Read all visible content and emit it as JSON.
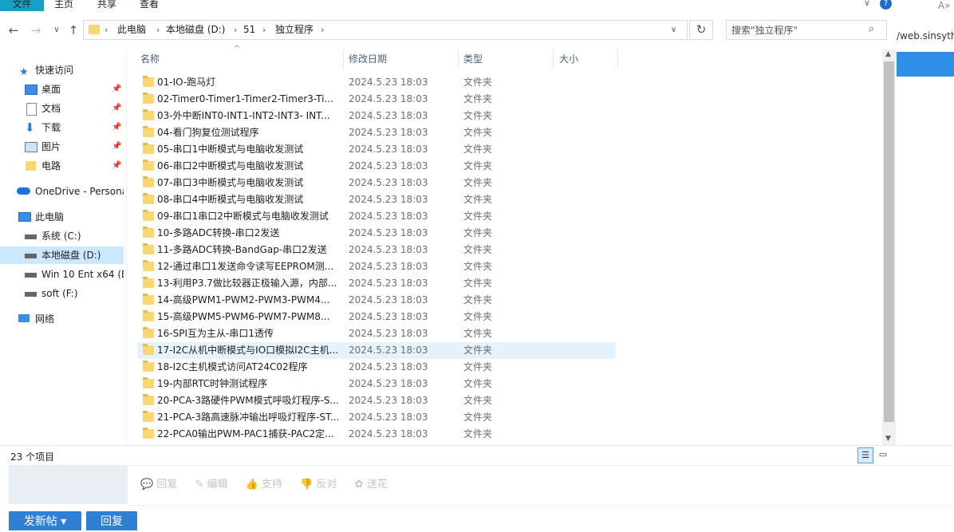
{
  "ribbon": {
    "tabs": [
      "文件",
      "主页",
      "共享",
      "查看"
    ]
  },
  "address": {
    "crumbs": [
      "此电脑",
      "本地磁盘 (D:)",
      "51",
      "独立程序"
    ]
  },
  "search": {
    "placeholder": "搜索\"独立程序\""
  },
  "sidebar": {
    "quick_access": "快速访问",
    "items": [
      "桌面",
      "文档",
      "下载",
      "图片",
      "电路"
    ],
    "onedrive": "OneDrive - Persona",
    "this_pc": "此电脑",
    "drives": [
      "系统 (C:)",
      "本地磁盘 (D:)",
      "Win 10 Ent x64 (E:",
      "soft (F:)"
    ],
    "network": "网络"
  },
  "columns": {
    "name": "名称",
    "date": "修改日期",
    "type": "类型",
    "size": "大小"
  },
  "files": [
    {
      "name": "01-IO-跑马灯",
      "date": "2024.5.23 18:03",
      "type": "文件夹"
    },
    {
      "name": "02-Timer0-Timer1-Timer2-Timer3-Ti...",
      "date": "2024.5.23 18:03",
      "type": "文件夹"
    },
    {
      "name": "03-外中断INT0-INT1-INT2-INT3- INT...",
      "date": "2024.5.23 18:03",
      "type": "文件夹"
    },
    {
      "name": "04-看门狗复位测试程序",
      "date": "2024.5.23 18:03",
      "type": "文件夹"
    },
    {
      "name": "05-串口1中断模式与电脑收发测试",
      "date": "2024.5.23 18:03",
      "type": "文件夹"
    },
    {
      "name": "06-串口2中断模式与电脑收发测试",
      "date": "2024.5.23 18:03",
      "type": "文件夹"
    },
    {
      "name": "07-串口3中断模式与电脑收发测试",
      "date": "2024.5.23 18:03",
      "type": "文件夹"
    },
    {
      "name": "08-串口4中断模式与电脑收发测试",
      "date": "2024.5.23 18:03",
      "type": "文件夹"
    },
    {
      "name": "09-串口1串口2中断模式与电脑收发测试",
      "date": "2024.5.23 18:03",
      "type": "文件夹"
    },
    {
      "name": "10-多路ADC转换-串口2发送",
      "date": "2024.5.23 18:03",
      "type": "文件夹"
    },
    {
      "name": "11-多路ADC转换-BandGap-串口2发送",
      "date": "2024.5.23 18:03",
      "type": "文件夹"
    },
    {
      "name": "12-通过串口1发送命令读写EEPROM测...",
      "date": "2024.5.23 18:03",
      "type": "文件夹"
    },
    {
      "name": "13-利用P3.7做比较器正极输入源，内部...",
      "date": "2024.5.23 18:03",
      "type": "文件夹"
    },
    {
      "name": "14-高级PWM1-PWM2-PWM3-PWM4...",
      "date": "2024.5.23 18:03",
      "type": "文件夹"
    },
    {
      "name": "15-高级PWM5-PWM6-PWM7-PWM8...",
      "date": "2024.5.23 18:03",
      "type": "文件夹"
    },
    {
      "name": "16-SPI互为主从-串口1透传",
      "date": "2024.5.23 18:03",
      "type": "文件夹"
    },
    {
      "name": "17-I2C从机中断模式与IO口模拟I2C主机...",
      "date": "2024.5.23 18:03",
      "type": "文件夹"
    },
    {
      "name": "18-I2C主机模式访问AT24C02程序",
      "date": "2024.5.23 18:03",
      "type": "文件夹"
    },
    {
      "name": "19-内部RTC时钟测试程序",
      "date": "2024.5.23 18:03",
      "type": "文件夹"
    },
    {
      "name": "20-PCA-3路硬件PWM模式呼吸灯程序-S...",
      "date": "2024.5.23 18:03",
      "type": "文件夹"
    },
    {
      "name": "21-PCA-3路高速脉冲输出呼吸灯程序-ST...",
      "date": "2024.5.23 18:03",
      "type": "文件夹"
    },
    {
      "name": "22-PCA0输出PWM-PAC1捕获-PAC2定...",
      "date": "2024.5.23 18:03",
      "type": "文件夹"
    }
  ],
  "status": {
    "count": "23 个项目"
  },
  "browser": {
    "url": "/web.sinsyth",
    "reply_toolbar": [
      "回复",
      "编辑",
      "支持",
      "反对",
      "送花"
    ],
    "post_button": "发新帖",
    "reply_button": "回复"
  },
  "colors": {
    "accent": "#19a0c8",
    "selection": "#e5f3ff",
    "folder": "#f8d775",
    "button": "#2f7fd4"
  }
}
